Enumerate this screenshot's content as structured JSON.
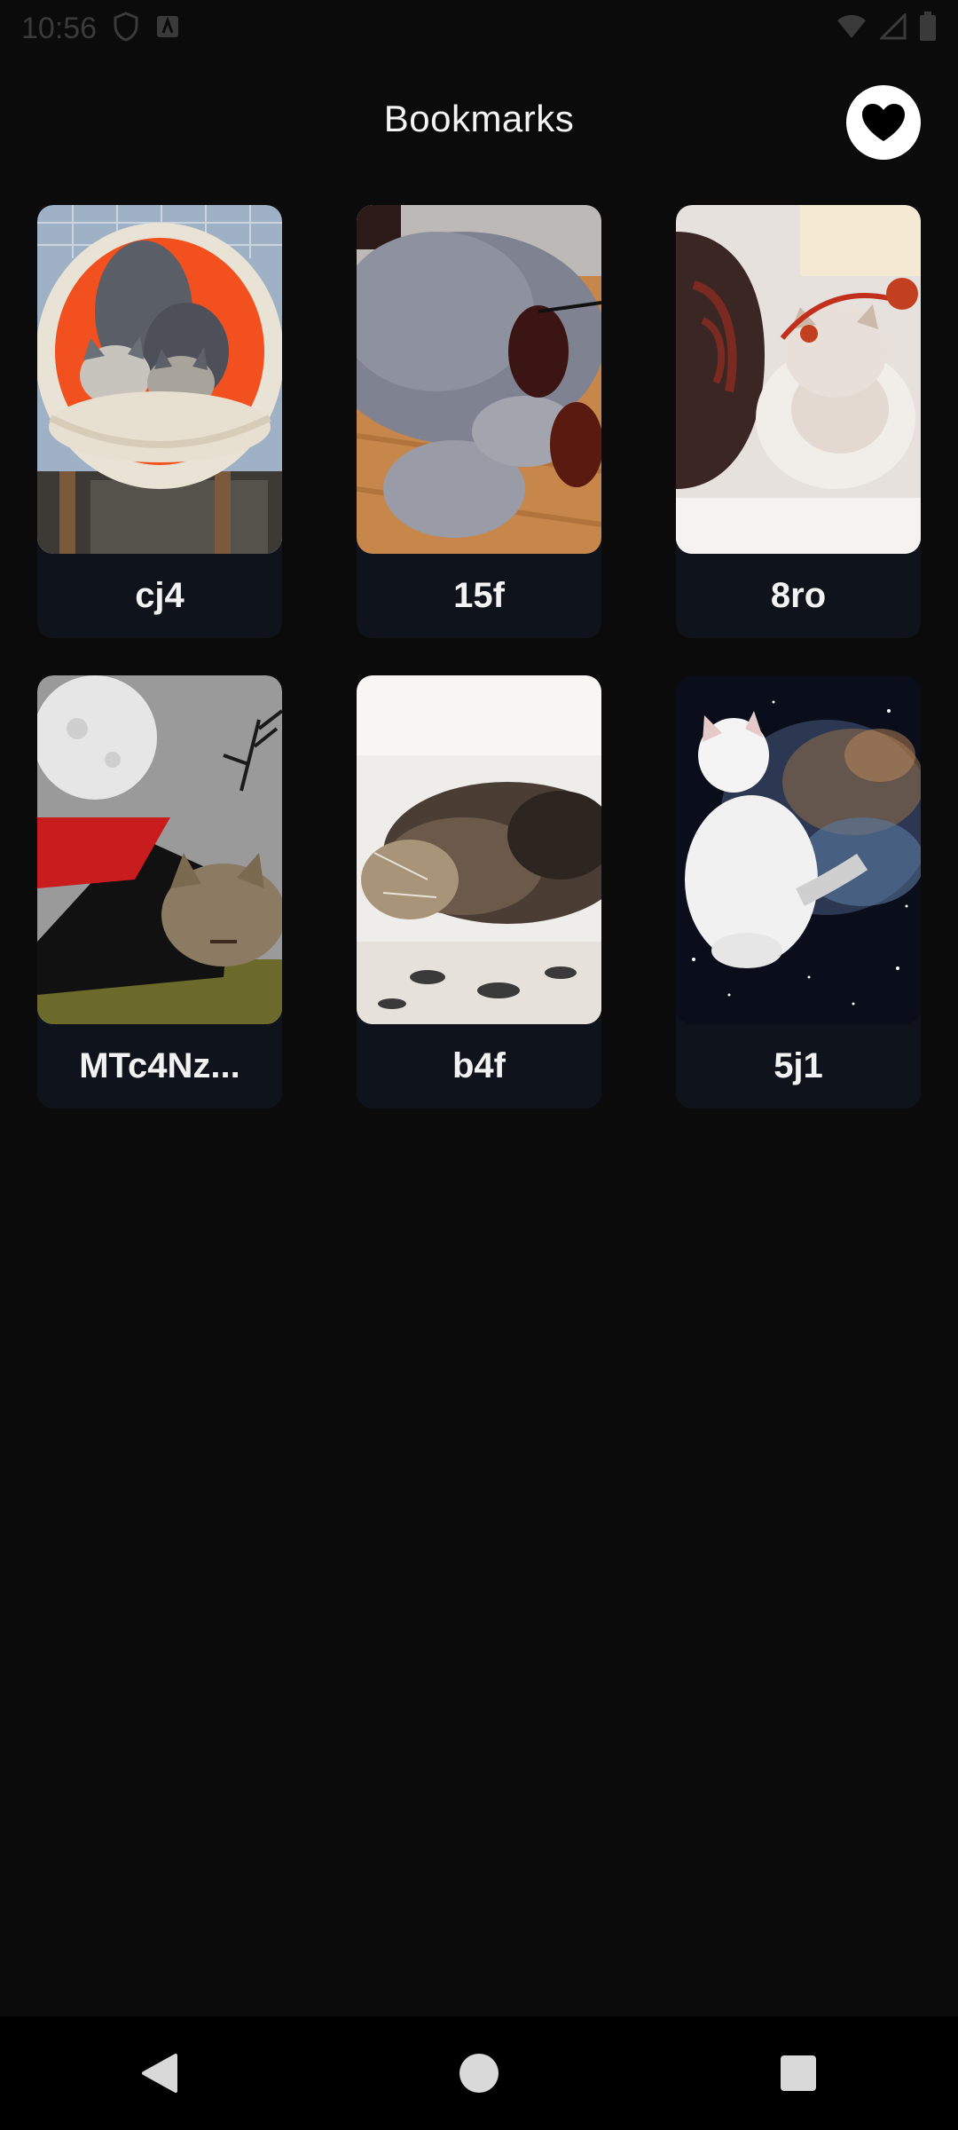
{
  "status": {
    "time": "10:56",
    "icons": [
      "shield-icon",
      "notification-a-icon",
      "wifi-icon",
      "signal-icon",
      "battery-icon"
    ]
  },
  "header": {
    "title": "Bookmarks",
    "favorites_icon": "heart-icon"
  },
  "bookmarks": [
    {
      "label": "cj4",
      "image": "two cats in an orange basket chair"
    },
    {
      "label": "15f",
      "image": "grey cat with sunglasses on wooden floor"
    },
    {
      "label": "8ro",
      "image": "persian cat with red headband"
    },
    {
      "label": "MTc4Nz...",
      "image": "tabby cat in vampire cape under moon"
    },
    {
      "label": "b4f",
      "image": "tabby kitten sleeping on blanket"
    },
    {
      "label": "5j1",
      "image": "white cat in space nebula"
    }
  ],
  "colors": {
    "background": "#0b0b0b",
    "card": "#0f131b",
    "nav": "#000000",
    "fav_button": "#ffffff"
  },
  "nav": {
    "icons": [
      "back-icon",
      "home-icon",
      "recents-icon"
    ]
  }
}
